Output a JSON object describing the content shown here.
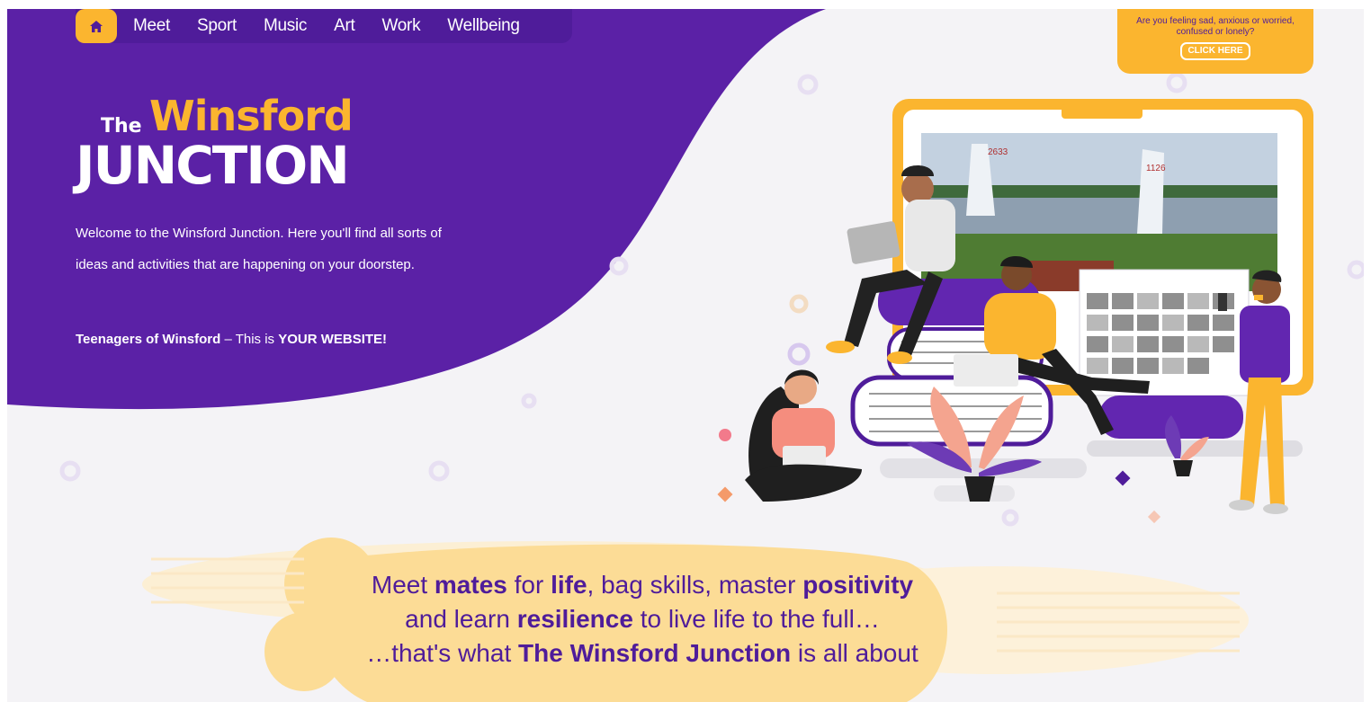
{
  "nav": {
    "home_icon": "home-icon",
    "items": [
      "Meet",
      "Sport",
      "Music",
      "Art",
      "Work",
      "Wellbeing"
    ]
  },
  "logo": {
    "the": "The",
    "winsford": "Winsford",
    "junction": "JUNCTION"
  },
  "intro": {
    "text": "Welcome to the Winsford Junction. Here you'll find all sorts of ideas and activities that are happening on your doorstep.",
    "tag_bold_1": "Teenagers of Winsford",
    "tag_plain": " – This is ",
    "tag_bold_2": "YOUR WEBSITE!"
  },
  "help": {
    "text": "Are you feeling sad, anxious or worried, confused or lonely?",
    "button": "CLICK HERE"
  },
  "photo": {
    "sail_numbers": [
      "2633",
      "1126"
    ]
  },
  "tagline": {
    "l1_a": "Meet ",
    "l1_b": "mates",
    "l1_c": " for ",
    "l1_d": "life",
    "l1_e": ", bag skills, master ",
    "l1_f": "positivity",
    "l2_a": "and learn ",
    "l2_b": "resilience",
    "l2_c": " to live life to the full…",
    "l3_a": "…that's what ",
    "l3_b": "The Winsford Junction",
    "l3_c": " is all about"
  },
  "colors": {
    "purple": "#4f1c9a",
    "purple_bg": "#5b21a6",
    "yellow": "#fbb52f",
    "background": "#f4f3f6"
  }
}
